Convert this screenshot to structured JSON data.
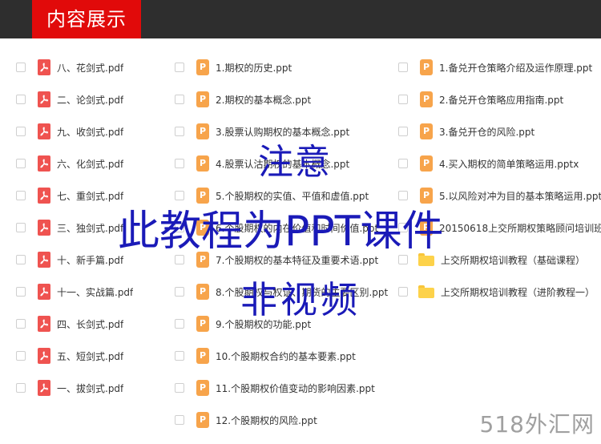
{
  "header": {
    "title": "内容展示"
  },
  "columns": [
    {
      "items": [
        {
          "name": "八、花剑式.pdf",
          "type": "pdf"
        },
        {
          "name": "二、论剑式.pdf",
          "type": "pdf"
        },
        {
          "name": "九、收剑式.pdf",
          "type": "pdf"
        },
        {
          "name": "六、化剑式.pdf",
          "type": "pdf"
        },
        {
          "name": "七、重剑式.pdf",
          "type": "pdf"
        },
        {
          "name": "三、独剑式.pdf",
          "type": "pdf"
        },
        {
          "name": "十、新手篇.pdf",
          "type": "pdf"
        },
        {
          "name": "十一、实战篇.pdf",
          "type": "pdf"
        },
        {
          "name": "四、长剑式.pdf",
          "type": "pdf"
        },
        {
          "name": "五、短剑式.pdf",
          "type": "pdf"
        },
        {
          "name": "一、拔剑式.pdf",
          "type": "pdf"
        }
      ]
    },
    {
      "items": [
        {
          "name": "1.期权的历史.ppt",
          "type": "ppt"
        },
        {
          "name": "2.期权的基本概念.ppt",
          "type": "ppt"
        },
        {
          "name": "3.股票认购期权的基本概念.ppt",
          "type": "ppt"
        },
        {
          "name": "4.股票认沽期权的基本概念.ppt",
          "type": "ppt"
        },
        {
          "name": "5.个股期权的实值、平值和虚值.ppt",
          "type": "ppt"
        },
        {
          "name": "6.个股期权的内在价值和时间价值.ppt",
          "type": "ppt"
        },
        {
          "name": "7.个股期权的基本特征及重要术语.ppt",
          "type": "ppt"
        },
        {
          "name": "8.个股期权与权证、期货的主要区别.ppt",
          "type": "ppt"
        },
        {
          "name": "9.个股期权的功能.ppt",
          "type": "ppt"
        },
        {
          "name": "10.个股期权合约的基本要素.ppt",
          "type": "ppt"
        },
        {
          "name": "11.个股期权价值变动的影响因素.ppt",
          "type": "ppt"
        },
        {
          "name": "12.个股期权的风险.ppt",
          "type": "ppt"
        }
      ]
    },
    {
      "items": [
        {
          "name": "1.备兑开仓策略介绍及运作原理.ppt",
          "type": "ppt"
        },
        {
          "name": "2.备兑开仓策略应用指南.ppt",
          "type": "ppt"
        },
        {
          "name": "3.备兑开仓的风险.ppt",
          "type": "ppt"
        },
        {
          "name": "4.买入期权的简单策略运用.pptx",
          "type": "ppt"
        },
        {
          "name": "5.以风险对冲为目的基本策略运用.ppt",
          "type": "ppt"
        },
        {
          "name": "20150618上交所期权策略顾问培训班",
          "type": "ppt"
        },
        {
          "name": "上交所期权培训教程（基础课程）",
          "type": "folder"
        },
        {
          "name": "上交所期权培训教程（进阶教程一）",
          "type": "folder"
        }
      ]
    }
  ],
  "icons": {
    "pdf": "pdf-file-icon",
    "ppt": "ppt-file-icon",
    "folder": "folder-icon",
    "ppt_glyph": "P"
  },
  "overlay": {
    "line1": "注意",
    "line2": "此教程为PPT课件",
    "line3": "非视频"
  },
  "watermark": "518外汇网",
  "colors": {
    "header_bg": "#2e2e2e",
    "title_bg": "#e10a0a",
    "pdf": "#ef5350",
    "ppt": "#f7a44b",
    "folder": "#fdd24a",
    "overlay_text": "#1a1ab8"
  }
}
